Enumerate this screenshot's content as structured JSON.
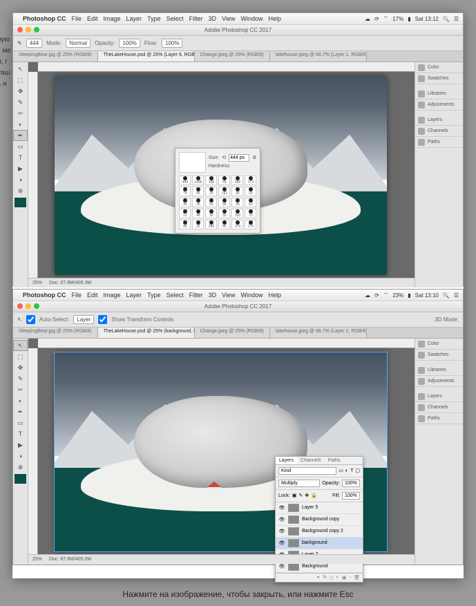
{
  "backdrop_text_fragments": "руют мел, гуашь и",
  "caption": "Нажмите на изображение, чтобы закрыть, или нажмите Esc",
  "menubar": {
    "apple_glyph": "",
    "app": "Photoshop CC",
    "items": [
      "File",
      "Edit",
      "Image",
      "Layer",
      "Type",
      "Select",
      "Filter",
      "3D",
      "View",
      "Window",
      "Help"
    ],
    "battery1": "17%",
    "time1": "Sat 13:12",
    "battery2": "23%",
    "time2": "Sat 13:10"
  },
  "titlebar": {
    "title": "Adobe Photoshop CC 2017"
  },
  "tabs": [
    {
      "label": "SleepingBear.jpg @ 25% (RGB/8)",
      "active": false
    },
    {
      "label": "TheLakeHouse.psd @ 25% (Layer 6, RGB/8) *",
      "active": true
    },
    {
      "label": "Change.jpeg @ 25% (RGB/8)",
      "active": false
    },
    {
      "label": "lakehouse.jpeg @ 66.7% (Layer 1, RGB/8) *",
      "active": false
    }
  ],
  "tabs2": [
    {
      "label": "SleepingBear.jpg @ 25% (RGB/8)",
      "active": false
    },
    {
      "label": "TheLakeHouse.psd @ 25% (background, RGB/8) *",
      "active": true
    },
    {
      "label": "Change.jpeg @ 25% (RGB/8)",
      "active": false
    },
    {
      "label": "lakehouse.jpeg @ 66.7% (Layer 1, RGB/8) *",
      "active": false
    }
  ],
  "optbar_brush": {
    "size": "444",
    "mode_lbl": "Mode:",
    "mode": "Normal",
    "opacity_lbl": "Opacity:",
    "opacity": "100%",
    "flow_lbl": "Flow:",
    "flow": "100%"
  },
  "optbar_move": {
    "auto_select": "Auto-Select:",
    "target": "Layer",
    "show_tc": "Show Transform Controls",
    "mode_lbl": "3D Mode:"
  },
  "brush_popup": {
    "size_lbl": "Size:",
    "size_val": "444 px",
    "hardness_lbl": "Hardness:",
    "presets": [
      "444",
      "1400",
      "198",
      "66",
      "268",
      "172",
      "74",
      "95",
      "29",
      "192",
      "36",
      "33",
      "36",
      "36",
      "63",
      "66",
      "39",
      "63",
      "11",
      "48",
      "32",
      "55",
      "100",
      "75",
      "45",
      "32",
      "284",
      "80",
      "174",
      "175"
    ]
  },
  "status": {
    "zoom": "25%",
    "doc1": "Doc: 87.8M/409.3M",
    "doc2": "Doc: 87.8M/405.0M"
  },
  "rightdock": [
    "Color",
    "Swatches",
    "Libraries",
    "Adjustments",
    "Layers",
    "Channels",
    "Paths"
  ],
  "layers_panel": {
    "tabs": [
      "Layers",
      "Channels",
      "Paths"
    ],
    "kind": "Kind",
    "blend": "Multiply",
    "opacity_lbl": "Opacity:",
    "opacity": "100%",
    "lock_lbl": "Lock:",
    "fill_lbl": "Fill:",
    "fill": "100%",
    "layers": [
      {
        "name": "Layer 5",
        "vis": true,
        "sel": false
      },
      {
        "name": "Background copy",
        "vis": true,
        "sel": false
      },
      {
        "name": "Background copy 2",
        "vis": true,
        "sel": false
      },
      {
        "name": "background",
        "vis": true,
        "sel": true
      },
      {
        "name": "Layer 7",
        "vis": true,
        "sel": false
      },
      {
        "name": "Background",
        "vis": true,
        "sel": false
      }
    ]
  },
  "tools": [
    "↖",
    "⬚",
    "✥",
    "✎",
    "✂",
    "◐",
    "✒",
    "▭",
    "T",
    "▶",
    "◑",
    "⊕",
    "⬢",
    "■"
  ]
}
